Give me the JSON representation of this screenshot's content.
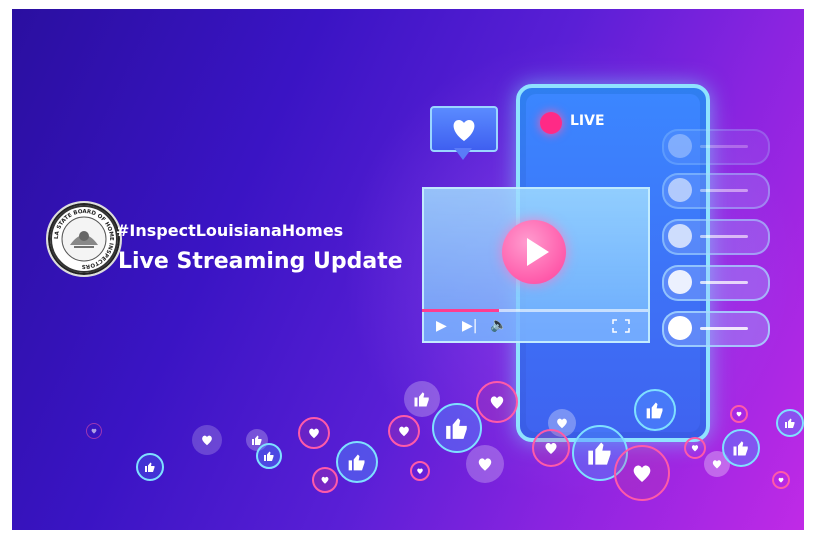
{
  "banner": {
    "hashtag": "#InspectLouisianaHomes",
    "headline": "Live Streaming Update"
  },
  "seal": {
    "text": "LA STATE BOARD OF HOME INSPECTORS"
  },
  "stream": {
    "live_label": "LIVE",
    "progress": 0.34
  },
  "colors": {
    "background_start": "#2a0fa0",
    "background_end": "#c02ae6",
    "live_dot": "#ff2a86",
    "phone_border": "#8fe3ff",
    "play_button": "#ff3f9b"
  },
  "icons": [
    "heart-icon",
    "play-icon",
    "thumbs-up-icon",
    "user-avatar-icon",
    "fullscreen-icon",
    "volume-icon",
    "skip-next-icon"
  ]
}
